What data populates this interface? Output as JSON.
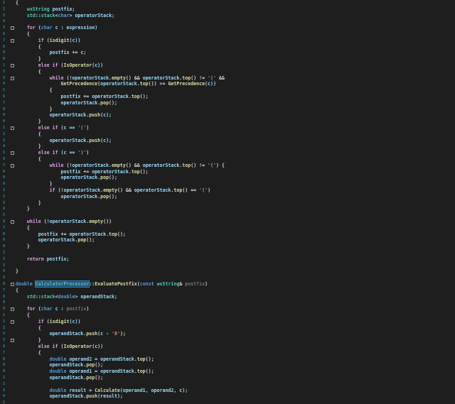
{
  "editor": {
    "theme": "dark",
    "colors": {
      "background": "#1e1e1e",
      "keyword": "#569cd6",
      "control": "#d8a0df",
      "type": "#4ec9b0",
      "function": "#dcdcaa",
      "variable": "#9cdcfe",
      "string": "#ce9178",
      "line_number": "#2b91af"
    },
    "line_numbers": [
      "1",
      "2",
      "3",
      "4",
      "5",
      "6",
      "7",
      "8",
      "9",
      "0",
      "1",
      "2",
      "3",
      "4",
      "5",
      "6",
      "7",
      "8",
      "9",
      "0",
      "1",
      "2",
      "3",
      "4",
      "5",
      "6",
      "7",
      "8",
      "9",
      "0",
      "1",
      "2",
      "3",
      "4",
      "5",
      "6",
      "7",
      "8",
      "9",
      "0",
      "1",
      "2",
      "3",
      "4",
      "5",
      "6",
      "7",
      "8",
      "9",
      "0",
      "1",
      "2",
      "3",
      "4",
      "5",
      "6",
      "7",
      "8",
      "9",
      "0",
      "1",
      "2",
      "3",
      "4",
      "5"
    ],
    "lines": [
      [
        {
          "t": "{",
          "c": "cb"
        }
      ],
      [
        {
          "t": "    ",
          "c": "cb"
        },
        {
          "t": "wxString",
          "c": "t-type"
        },
        {
          "t": " postfix;",
          "c": "t-var"
        }
      ],
      [
        {
          "t": "    ",
          "c": "cb"
        },
        {
          "t": "std",
          "c": "t-type"
        },
        {
          "t": "::",
          "c": "cb"
        },
        {
          "t": "stack",
          "c": "t-type"
        },
        {
          "t": "<",
          "c": "cb"
        },
        {
          "t": "char",
          "c": "t-kw"
        },
        {
          "t": "> operatorStack;",
          "c": "t-var"
        }
      ],
      [
        {
          "t": "",
          "c": "cb"
        }
      ],
      [
        {
          "t": "    ",
          "c": "cb"
        },
        {
          "t": "for",
          "c": "t-ctl"
        },
        {
          "t": " (",
          "c": "cb"
        },
        {
          "t": "char",
          "c": "t-kw"
        },
        {
          "t": " c : expression)",
          "c": "t-var"
        }
      ],
      [
        {
          "t": "    {",
          "c": "cb"
        }
      ],
      [
        {
          "t": "        ",
          "c": "cb"
        },
        {
          "t": "if",
          "c": "t-ctl"
        },
        {
          "t": " (",
          "c": "cb"
        },
        {
          "t": "isdigit",
          "c": "t-fn"
        },
        {
          "t": "(c))",
          "c": "t-var"
        }
      ],
      [
        {
          "t": "        {",
          "c": "cb"
        }
      ],
      [
        {
          "t": "            ",
          "c": "cb"
        },
        {
          "t": "postfix",
          "c": "t-var"
        },
        {
          "t": " += ",
          "c": "cb"
        },
        {
          "t": "c;",
          "c": "t-var"
        }
      ],
      [
        {
          "t": "        }",
          "c": "cb"
        }
      ],
      [
        {
          "t": "        ",
          "c": "cb"
        },
        {
          "t": "else if",
          "c": "t-ctl"
        },
        {
          "t": " (",
          "c": "cb"
        },
        {
          "t": "IsOperator",
          "c": "t-fn"
        },
        {
          "t": "(c))",
          "c": "t-var"
        }
      ],
      [
        {
          "t": "        {",
          "c": "cb"
        }
      ],
      [
        {
          "t": "            ",
          "c": "cb"
        },
        {
          "t": "while",
          "c": "t-ctl"
        },
        {
          "t": " (!",
          "c": "cb"
        },
        {
          "t": "operatorStack",
          "c": "t-var"
        },
        {
          "t": ".",
          "c": "cb"
        },
        {
          "t": "empty",
          "c": "t-fn"
        },
        {
          "t": "() && ",
          "c": "cb"
        },
        {
          "t": "operatorStack",
          "c": "t-var"
        },
        {
          "t": ".",
          "c": "cb"
        },
        {
          "t": "top",
          "c": "t-fn"
        },
        {
          "t": "() != ",
          "c": "cb"
        },
        {
          "t": "'('",
          "c": "t-str"
        },
        {
          "t": " &&",
          "c": "cb"
        }
      ],
      [
        {
          "t": "                ",
          "c": "cb"
        },
        {
          "t": "GetPrecedence",
          "c": "t-fn"
        },
        {
          "t": "(",
          "c": "cb"
        },
        {
          "t": "operatorStack",
          "c": "t-var"
        },
        {
          "t": ".",
          "c": "cb"
        },
        {
          "t": "top",
          "c": "t-fn"
        },
        {
          "t": "()) >= ",
          "c": "cb"
        },
        {
          "t": "GetPrecedence",
          "c": "t-fn"
        },
        {
          "t": "(c))",
          "c": "t-var"
        }
      ],
      [
        {
          "t": "            {",
          "c": "cb"
        }
      ],
      [
        {
          "t": "                ",
          "c": "cb"
        },
        {
          "t": "postfix",
          "c": "t-var"
        },
        {
          "t": " += ",
          "c": "cb"
        },
        {
          "t": "operatorStack",
          "c": "t-var"
        },
        {
          "t": ".",
          "c": "cb"
        },
        {
          "t": "top",
          "c": "t-fn"
        },
        {
          "t": "();",
          "c": "cb"
        }
      ],
      [
        {
          "t": "                ",
          "c": "cb"
        },
        {
          "t": "operatorStack",
          "c": "t-var"
        },
        {
          "t": ".",
          "c": "cb"
        },
        {
          "t": "pop",
          "c": "t-fn"
        },
        {
          "t": "();",
          "c": "cb"
        }
      ],
      [
        {
          "t": "            }",
          "c": "cb"
        }
      ],
      [
        {
          "t": "            ",
          "c": "cb"
        },
        {
          "t": "operatorStack",
          "c": "t-var"
        },
        {
          "t": ".",
          "c": "cb"
        },
        {
          "t": "push",
          "c": "t-fn"
        },
        {
          "t": "(c);",
          "c": "t-var"
        }
      ],
      [
        {
          "t": "        }",
          "c": "cb"
        }
      ],
      [
        {
          "t": "        ",
          "c": "cb"
        },
        {
          "t": "else if",
          "c": "t-ctl"
        },
        {
          "t": " (c == ",
          "c": "t-var"
        },
        {
          "t": "'('",
          "c": "t-str"
        },
        {
          "t": ")",
          "c": "cb"
        }
      ],
      [
        {
          "t": "        {",
          "c": "cb"
        }
      ],
      [
        {
          "t": "            ",
          "c": "cb"
        },
        {
          "t": "operatorStack",
          "c": "t-var"
        },
        {
          "t": ".",
          "c": "cb"
        },
        {
          "t": "push",
          "c": "t-fn"
        },
        {
          "t": "(c);",
          "c": "t-var"
        }
      ],
      [
        {
          "t": "        }",
          "c": "cb"
        }
      ],
      [
        {
          "t": "        ",
          "c": "cb"
        },
        {
          "t": "else if",
          "c": "t-ctl"
        },
        {
          "t": " (c == ",
          "c": "t-var"
        },
        {
          "t": "')'",
          "c": "t-str"
        },
        {
          "t": ")",
          "c": "cb"
        }
      ],
      [
        {
          "t": "        {",
          "c": "cb"
        }
      ],
      [
        {
          "t": "            ",
          "c": "cb"
        },
        {
          "t": "while",
          "c": "t-ctl"
        },
        {
          "t": " (!",
          "c": "cb"
        },
        {
          "t": "operatorStack",
          "c": "t-var"
        },
        {
          "t": ".",
          "c": "cb"
        },
        {
          "t": "empty",
          "c": "t-fn"
        },
        {
          "t": "() && ",
          "c": "cb"
        },
        {
          "t": "operatorStack",
          "c": "t-var"
        },
        {
          "t": ".",
          "c": "cb"
        },
        {
          "t": "top",
          "c": "t-fn"
        },
        {
          "t": "() != ",
          "c": "cb"
        },
        {
          "t": "'('",
          "c": "t-str"
        },
        {
          "t": ") {",
          "c": "cb"
        }
      ],
      [
        {
          "t": "                ",
          "c": "cb"
        },
        {
          "t": "postfix",
          "c": "t-var"
        },
        {
          "t": " += ",
          "c": "cb"
        },
        {
          "t": "operatorStack",
          "c": "t-var"
        },
        {
          "t": ".",
          "c": "cb"
        },
        {
          "t": "top",
          "c": "t-fn"
        },
        {
          "t": "();",
          "c": "cb"
        }
      ],
      [
        {
          "t": "                ",
          "c": "cb"
        },
        {
          "t": "operatorStack",
          "c": "t-var"
        },
        {
          "t": ".",
          "c": "cb"
        },
        {
          "t": "pop",
          "c": "t-fn"
        },
        {
          "t": "();",
          "c": "cb"
        }
      ],
      [
        {
          "t": "            }",
          "c": "cb"
        }
      ],
      [
        {
          "t": "            ",
          "c": "cb"
        },
        {
          "t": "if",
          "c": "t-ctl"
        },
        {
          "t": " (!",
          "c": "cb"
        },
        {
          "t": "operatorStack",
          "c": "t-var"
        },
        {
          "t": ".",
          "c": "cb"
        },
        {
          "t": "empty",
          "c": "t-fn"
        },
        {
          "t": "() && ",
          "c": "cb"
        },
        {
          "t": "operatorStack",
          "c": "t-var"
        },
        {
          "t": ".",
          "c": "cb"
        },
        {
          "t": "top",
          "c": "t-fn"
        },
        {
          "t": "() == ",
          "c": "cb"
        },
        {
          "t": "'('",
          "c": "t-str"
        },
        {
          "t": ")",
          "c": "cb"
        }
      ],
      [
        {
          "t": "                ",
          "c": "cb"
        },
        {
          "t": "operatorStack",
          "c": "t-var"
        },
        {
          "t": ".",
          "c": "cb"
        },
        {
          "t": "pop",
          "c": "t-fn"
        },
        {
          "t": "();",
          "c": "cb"
        }
      ],
      [
        {
          "t": "        }",
          "c": "cb"
        }
      ],
      [
        {
          "t": "    }",
          "c": "cb"
        }
      ],
      [
        {
          "t": "",
          "c": "cb"
        }
      ],
      [
        {
          "t": "    ",
          "c": "cb"
        },
        {
          "t": "while",
          "c": "t-ctl"
        },
        {
          "t": " (!",
          "c": "cb"
        },
        {
          "t": "operatorStack",
          "c": "t-var"
        },
        {
          "t": ".",
          "c": "cb"
        },
        {
          "t": "empty",
          "c": "t-fn"
        },
        {
          "t": "())",
          "c": "cb"
        }
      ],
      [
        {
          "t": "    {",
          "c": "cb"
        }
      ],
      [
        {
          "t": "        ",
          "c": "cb"
        },
        {
          "t": "postfix",
          "c": "t-var"
        },
        {
          "t": " += ",
          "c": "cb"
        },
        {
          "t": "operatorStack",
          "c": "t-var"
        },
        {
          "t": ".",
          "c": "cb"
        },
        {
          "t": "top",
          "c": "t-fn"
        },
        {
          "t": "();",
          "c": "cb"
        }
      ],
      [
        {
          "t": "        ",
          "c": "cb"
        },
        {
          "t": "operatorStack",
          "c": "t-var"
        },
        {
          "t": ".",
          "c": "cb"
        },
        {
          "t": "pop",
          "c": "t-fn"
        },
        {
          "t": "();",
          "c": "cb"
        }
      ],
      [
        {
          "t": "    }",
          "c": "cb"
        }
      ],
      [
        {
          "t": "",
          "c": "cb"
        }
      ],
      [
        {
          "t": "    ",
          "c": "cb"
        },
        {
          "t": "return",
          "c": "t-ctl"
        },
        {
          "t": " postfix;",
          "c": "t-var"
        }
      ],
      [
        {
          "t": "",
          "c": "cb"
        }
      ],
      [
        {
          "t": "}",
          "c": "cb"
        }
      ],
      [
        {
          "t": "",
          "c": "cb"
        }
      ],
      [
        {
          "t": "double",
          "c": "t-kw"
        },
        {
          "t": " ",
          "c": "cb"
        },
        {
          "t": "CalculatorProcessor",
          "c": "t-hl"
        },
        {
          "t": "::",
          "c": "cb"
        },
        {
          "t": "EvaluatePostfix",
          "c": "t-fn"
        },
        {
          "t": "(",
          "c": "cb"
        },
        {
          "t": "const",
          "c": "t-kw"
        },
        {
          "t": " ",
          "c": "cb"
        },
        {
          "t": "wxString",
          "c": "t-type"
        },
        {
          "t": "& ",
          "c": "cb"
        },
        {
          "t": "postfix",
          "c": "t-param"
        },
        {
          "t": ")",
          "c": "cb"
        }
      ],
      [
        {
          "t": "{",
          "c": "cb"
        }
      ],
      [
        {
          "t": "    ",
          "c": "cb"
        },
        {
          "t": "std",
          "c": "t-type"
        },
        {
          "t": "::",
          "c": "cb"
        },
        {
          "t": "stack",
          "c": "t-type"
        },
        {
          "t": "<",
          "c": "cb"
        },
        {
          "t": "double",
          "c": "t-kw"
        },
        {
          "t": "> operandStack;",
          "c": "t-var"
        }
      ],
      [
        {
          "t": "",
          "c": "cb"
        }
      ],
      [
        {
          "t": "    ",
          "c": "cb"
        },
        {
          "t": "for",
          "c": "t-ctl"
        },
        {
          "t": " (",
          "c": "cb"
        },
        {
          "t": "char",
          "c": "t-kw"
        },
        {
          "t": " c : ",
          "c": "t-var"
        },
        {
          "t": "postfix",
          "c": "t-param"
        },
        {
          "t": ")",
          "c": "cb"
        }
      ],
      [
        {
          "t": "    {",
          "c": "cb"
        }
      ],
      [
        {
          "t": "        ",
          "c": "cb"
        },
        {
          "t": "if",
          "c": "t-ctl"
        },
        {
          "t": " (",
          "c": "cb"
        },
        {
          "t": "isdigit",
          "c": "t-fn"
        },
        {
          "t": "(c))",
          "c": "t-var"
        }
      ],
      [
        {
          "t": "        {",
          "c": "cb"
        }
      ],
      [
        {
          "t": "            ",
          "c": "cb"
        },
        {
          "t": "operandStack",
          "c": "t-var"
        },
        {
          "t": ".",
          "c": "cb"
        },
        {
          "t": "push",
          "c": "t-fn"
        },
        {
          "t": "(c - ",
          "c": "t-var"
        },
        {
          "t": "'0'",
          "c": "t-str"
        },
        {
          "t": ");",
          "c": "cb"
        }
      ],
      [
        {
          "t": "        }",
          "c": "cb"
        }
      ],
      [
        {
          "t": "        ",
          "c": "cb"
        },
        {
          "t": "else if",
          "c": "t-ctl"
        },
        {
          "t": " (",
          "c": "cb"
        },
        {
          "t": "IsOperator",
          "c": "t-fn"
        },
        {
          "t": "(c))",
          "c": "t-var"
        }
      ],
      [
        {
          "t": "        {",
          "c": "cb"
        }
      ],
      [
        {
          "t": "            ",
          "c": "cb"
        },
        {
          "t": "double",
          "c": "t-kw"
        },
        {
          "t": " operand2 = ",
          "c": "t-var"
        },
        {
          "t": "operandStack",
          "c": "t-var"
        },
        {
          "t": ".",
          "c": "cb"
        },
        {
          "t": "top",
          "c": "t-fn"
        },
        {
          "t": "();",
          "c": "cb"
        }
      ],
      [
        {
          "t": "            ",
          "c": "cb"
        },
        {
          "t": "operandStack",
          "c": "t-var"
        },
        {
          "t": ".",
          "c": "cb"
        },
        {
          "t": "pop",
          "c": "t-fn"
        },
        {
          "t": "();",
          "c": "cb"
        }
      ],
      [
        {
          "t": "            ",
          "c": "cb"
        },
        {
          "t": "double",
          "c": "t-kw"
        },
        {
          "t": " operand1 = ",
          "c": "t-var"
        },
        {
          "t": "operandStack",
          "c": "t-var"
        },
        {
          "t": ".",
          "c": "cb"
        },
        {
          "t": "top",
          "c": "t-fn"
        },
        {
          "t": "();",
          "c": "cb"
        }
      ],
      [
        {
          "t": "            ",
          "c": "cb"
        },
        {
          "t": "operandStack",
          "c": "t-var"
        },
        {
          "t": ".",
          "c": "cb"
        },
        {
          "t": "pop",
          "c": "t-fn"
        },
        {
          "t": "();",
          "c": "cb"
        }
      ],
      [
        {
          "t": "",
          "c": "cb"
        }
      ],
      [
        {
          "t": "            ",
          "c": "cb"
        },
        {
          "t": "double",
          "c": "t-kw"
        },
        {
          "t": " result = ",
          "c": "t-var"
        },
        {
          "t": "Calculate",
          "c": "t-fn"
        },
        {
          "t": "(operand1, operand2, c);",
          "c": "t-var"
        }
      ],
      [
        {
          "t": "            ",
          "c": "cb"
        },
        {
          "t": "operandStack",
          "c": "t-var"
        },
        {
          "t": ".",
          "c": "cb"
        },
        {
          "t": "push",
          "c": "t-fn"
        },
        {
          "t": "(result);",
          "c": "t-var"
        }
      ],
      [
        {
          "t": "",
          "c": "cb"
        }
      ]
    ],
    "fold_markers": {
      "4": "-",
      "6": "-",
      "10": "-",
      "12": "-",
      "20": "-",
      "24": "-",
      "26": "-",
      "35": "-",
      "45": "-",
      "49": "-",
      "51": "-",
      "54": "-"
    }
  }
}
